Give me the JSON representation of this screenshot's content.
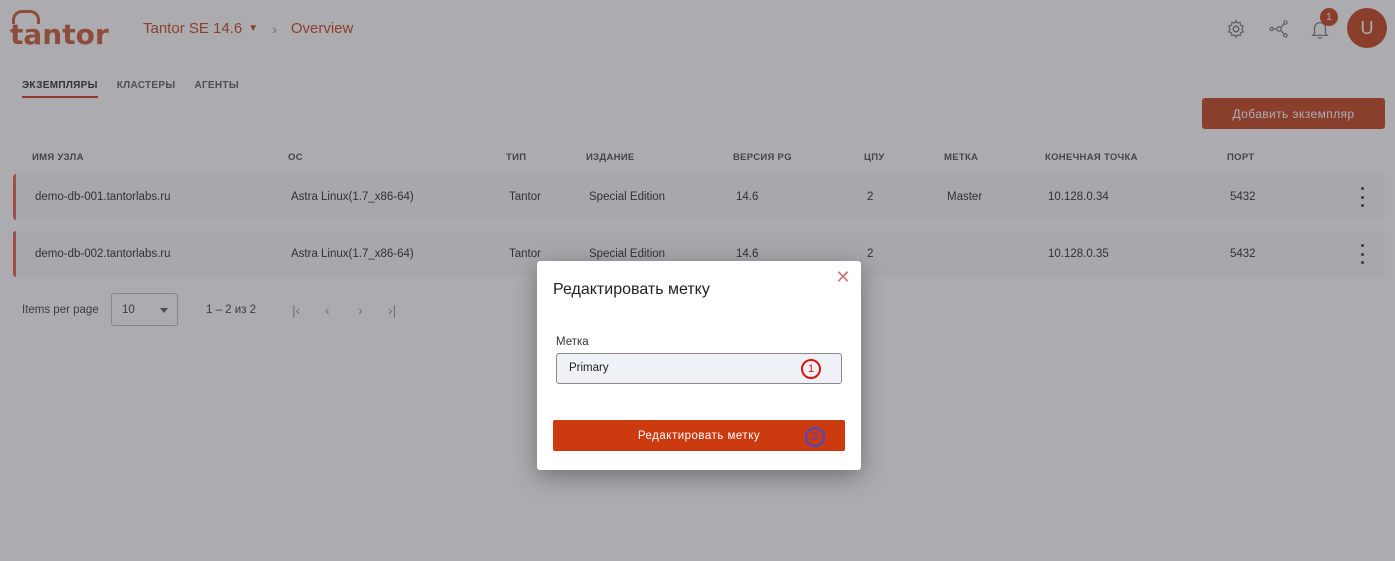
{
  "header": {
    "brand": "tantor",
    "product": "Tantor SE 14.6",
    "page": "Overview",
    "notifications_count": "1",
    "avatar_initial": "U"
  },
  "tabs": [
    {
      "label": "ЭКЗЕМПЛЯРЫ",
      "active": true
    },
    {
      "label": "КЛАСТЕРЫ",
      "active": false
    },
    {
      "label": "АГЕНТЫ",
      "active": false
    }
  ],
  "add_button": "Добавить экземпляр",
  "table": {
    "columns": [
      "ИМЯ УЗЛА",
      "ОС",
      "ТИП",
      "ИЗДАНИЕ",
      "ВЕРСИЯ PG",
      "ЦПУ",
      "МЕТКА",
      "КОНЕЧНАЯ ТОЧКА",
      "ПОРТ"
    ],
    "rows": [
      [
        "demo-db-001.tantorlabs.ru",
        "Astra Linux(1.7_x86-64)",
        "Tantor",
        "Special Edition",
        "14.6",
        "2",
        "Master",
        "10.128.0.34",
        "5432"
      ],
      [
        "demo-db-002.tantorlabs.ru",
        "Astra Linux(1.7_x86-64)",
        "Tantor",
        "Special Edition",
        "14.6",
        "2",
        "",
        "10.128.0.35",
        "5432"
      ]
    ]
  },
  "pagination": {
    "items_per_page_label": "Items per page",
    "items_per_page_value": "10",
    "range": "1 – 2 из 2"
  },
  "dialog": {
    "title": "Редактировать метку",
    "field_label": "Метка",
    "field_value": "Primary",
    "submit_label": "Редактировать метку",
    "step1": "1",
    "step2": "2"
  },
  "colors": {
    "accent": "#c23a12",
    "row_marker": "#e85548"
  }
}
